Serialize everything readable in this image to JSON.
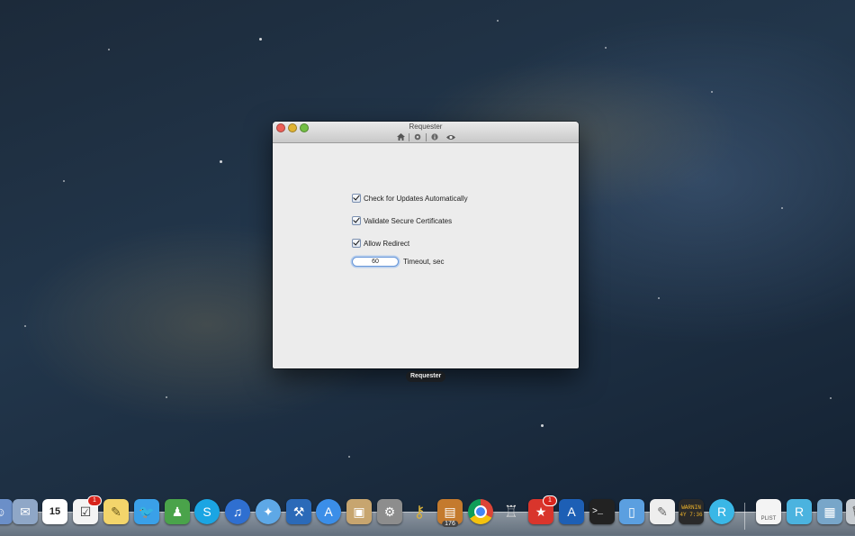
{
  "window": {
    "title": "Requester",
    "toolbar": [
      "home-icon",
      "gear-icon",
      "info-icon",
      "eye-icon"
    ]
  },
  "settings": {
    "check_updates": {
      "label": "Check for Updates Automatically",
      "checked": true
    },
    "validate_certs": {
      "label": "Validate Secure Certificates",
      "checked": true
    },
    "allow_redirect": {
      "label": "Allow Redirect",
      "checked": true
    },
    "timeout": {
      "value": "60",
      "label": "Timeout, sec"
    }
  },
  "tooltip": {
    "text": "Requester"
  },
  "dock": {
    "calendar_day": "15",
    "reminders_badge": "1",
    "todo_badge": "1",
    "mail_count": "176",
    "console_text_line1": "WARNIN",
    "console_text_line2": "4Y 7:36",
    "plist_label": "PLIST"
  }
}
